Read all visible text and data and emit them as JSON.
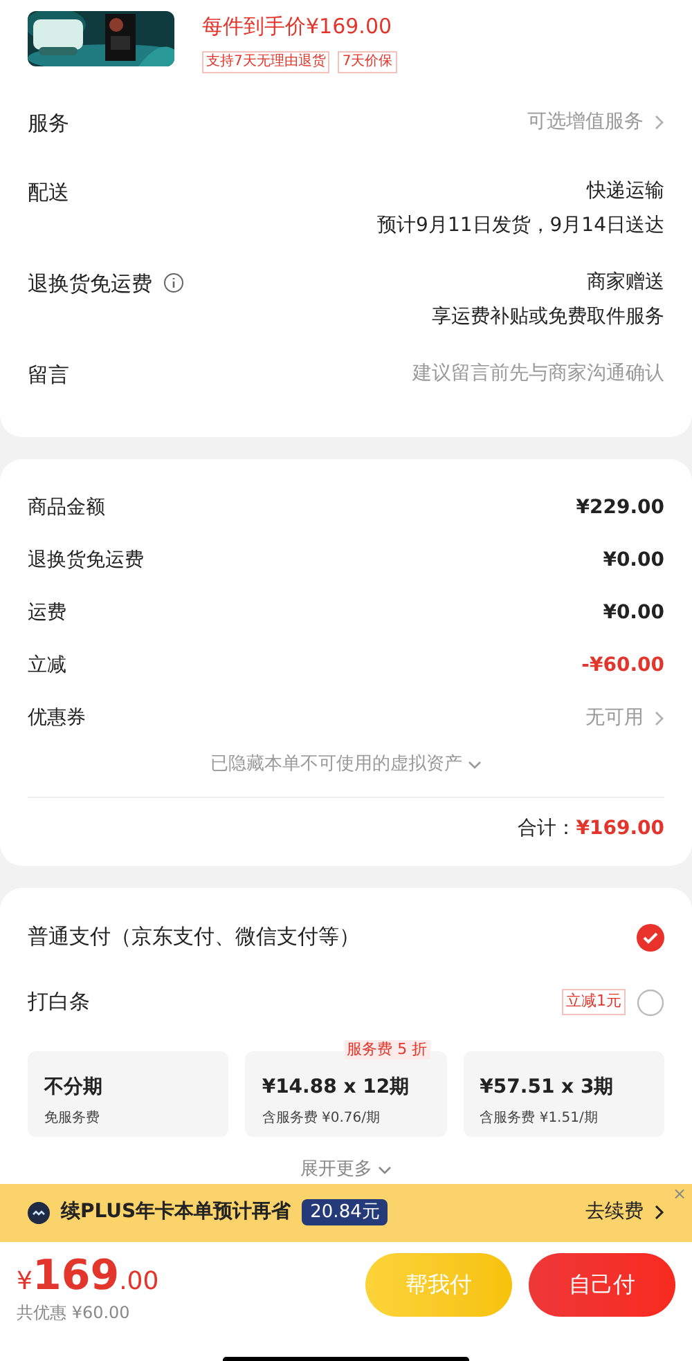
{
  "product": {
    "price": "每件到手价¥169.00",
    "tags": [
      "支持7天无理由退货",
      "7天价保"
    ]
  },
  "order_rows": [
    {
      "label": "服务",
      "value": [
        "可选增值服务"
      ],
      "kind": "option"
    },
    {
      "label": "配送",
      "value": [
        "快递运输",
        "预计9月11日发货，9月14日送达"
      ],
      "kind": "plain"
    },
    {
      "label": "退换货免运费",
      "value": [
        "商家赠送",
        "享运费补贴或免费取件服务"
      ],
      "kind": "info"
    },
    {
      "label": "留言",
      "value": [
        "建议留言前先与商家沟通确认"
      ],
      "kind": "hint"
    }
  ],
  "amounts": [
    {
      "label": "商品金额",
      "value": "¥229.00",
      "kind": "plain"
    },
    {
      "label": "退换货免运费",
      "value": "¥0.00",
      "kind": "plain"
    },
    {
      "label": "运费",
      "value": "¥0.00",
      "kind": "plain"
    },
    {
      "label": "立减",
      "value": "-¥60.00",
      "kind": "discount"
    },
    {
      "label": "优惠券",
      "value": "无可用",
      "kind": "link"
    }
  ],
  "hidden_note": "已隐藏本单不可使用的虚拟资产",
  "total": {
    "label": "合计：",
    "value": "¥169.00"
  },
  "payment_methods": [
    {
      "label": "普通支付（京东支付、微信支付等）",
      "selected": true
    },
    {
      "label": "打白条",
      "badge": "立减1元",
      "selected": false
    }
  ],
  "installments": [
    {
      "title": "不分期",
      "note": "免服务费"
    },
    {
      "title": "¥14.88 x 12期",
      "note": "含服务费 ¥0.76/期",
      "promo": "服务费 5 折"
    },
    {
      "title": "¥57.51 x 3期",
      "note": "含服务费 ¥1.51/期"
    }
  ],
  "expand_more": "展开更多",
  "plus_banner": {
    "text": "续PLUS年卡本单预计再省",
    "amount": "20.84元",
    "action": "去续费",
    "close": "×"
  },
  "footer": {
    "currency": "¥",
    "integer": "169",
    "decimals": ".00",
    "saving": "共优惠 ¥60.00",
    "buttons": [
      {
        "label": "帮我付",
        "kind": "secondary"
      },
      {
        "label": "自己付",
        "kind": "primary"
      }
    ]
  }
}
